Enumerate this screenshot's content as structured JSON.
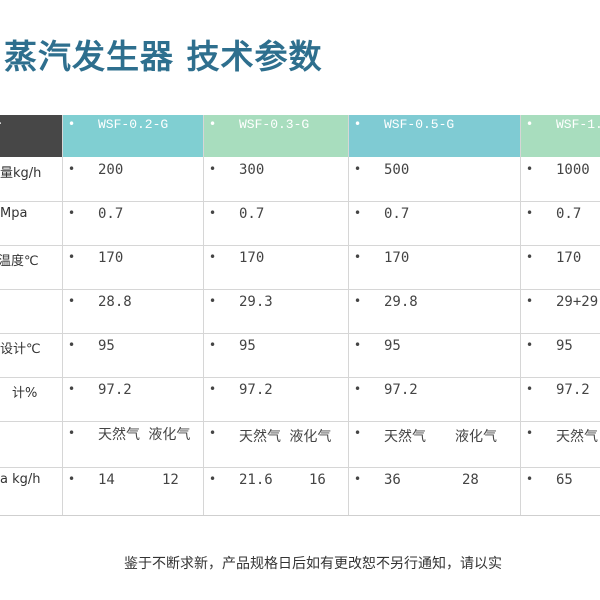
{
  "title": "蒸汽发生器 技术参数",
  "header": {
    "corner_mark": "·",
    "models": [
      "WSF-0.2-G",
      "WSF-0.3-G",
      "WSF-0.5-G",
      "WSF-1."
    ]
  },
  "rows": [
    {
      "label": "量kg/h",
      "values": [
        "200",
        "300",
        "500",
        "1000"
      ]
    },
    {
      "label": "Mpa",
      "values": [
        "0.7",
        "0.7",
        "0.7",
        "0.7"
      ]
    },
    {
      "label": "温度℃",
      "values": [
        "170",
        "170",
        "170",
        "170"
      ]
    },
    {
      "label": "",
      "values": [
        "28.8",
        "29.3",
        "29.8",
        "29+29."
      ]
    },
    {
      "label": "设计℃",
      "values": [
        "95",
        "95",
        "95",
        "95"
      ]
    },
    {
      "label": "计%",
      "values": [
        "97.2",
        "97.2",
        "97.2",
        "97.2"
      ]
    },
    {
      "label": "",
      "values": [
        "天然气 液化气",
        "天然气 液化气",
        "天然气",
        "天然气"
      ],
      "second": [
        "",
        "",
        "液化气",
        ""
      ]
    },
    {
      "label": "a kg/h",
      "values": [
        "14",
        "21.6",
        "36",
        "65"
      ],
      "second": [
        "12",
        "16",
        "28",
        ""
      ]
    }
  ],
  "bullet": "•",
  "footer": "鉴于不断求新，产品规格日后如有更改恕不另行通知，请以实"
}
